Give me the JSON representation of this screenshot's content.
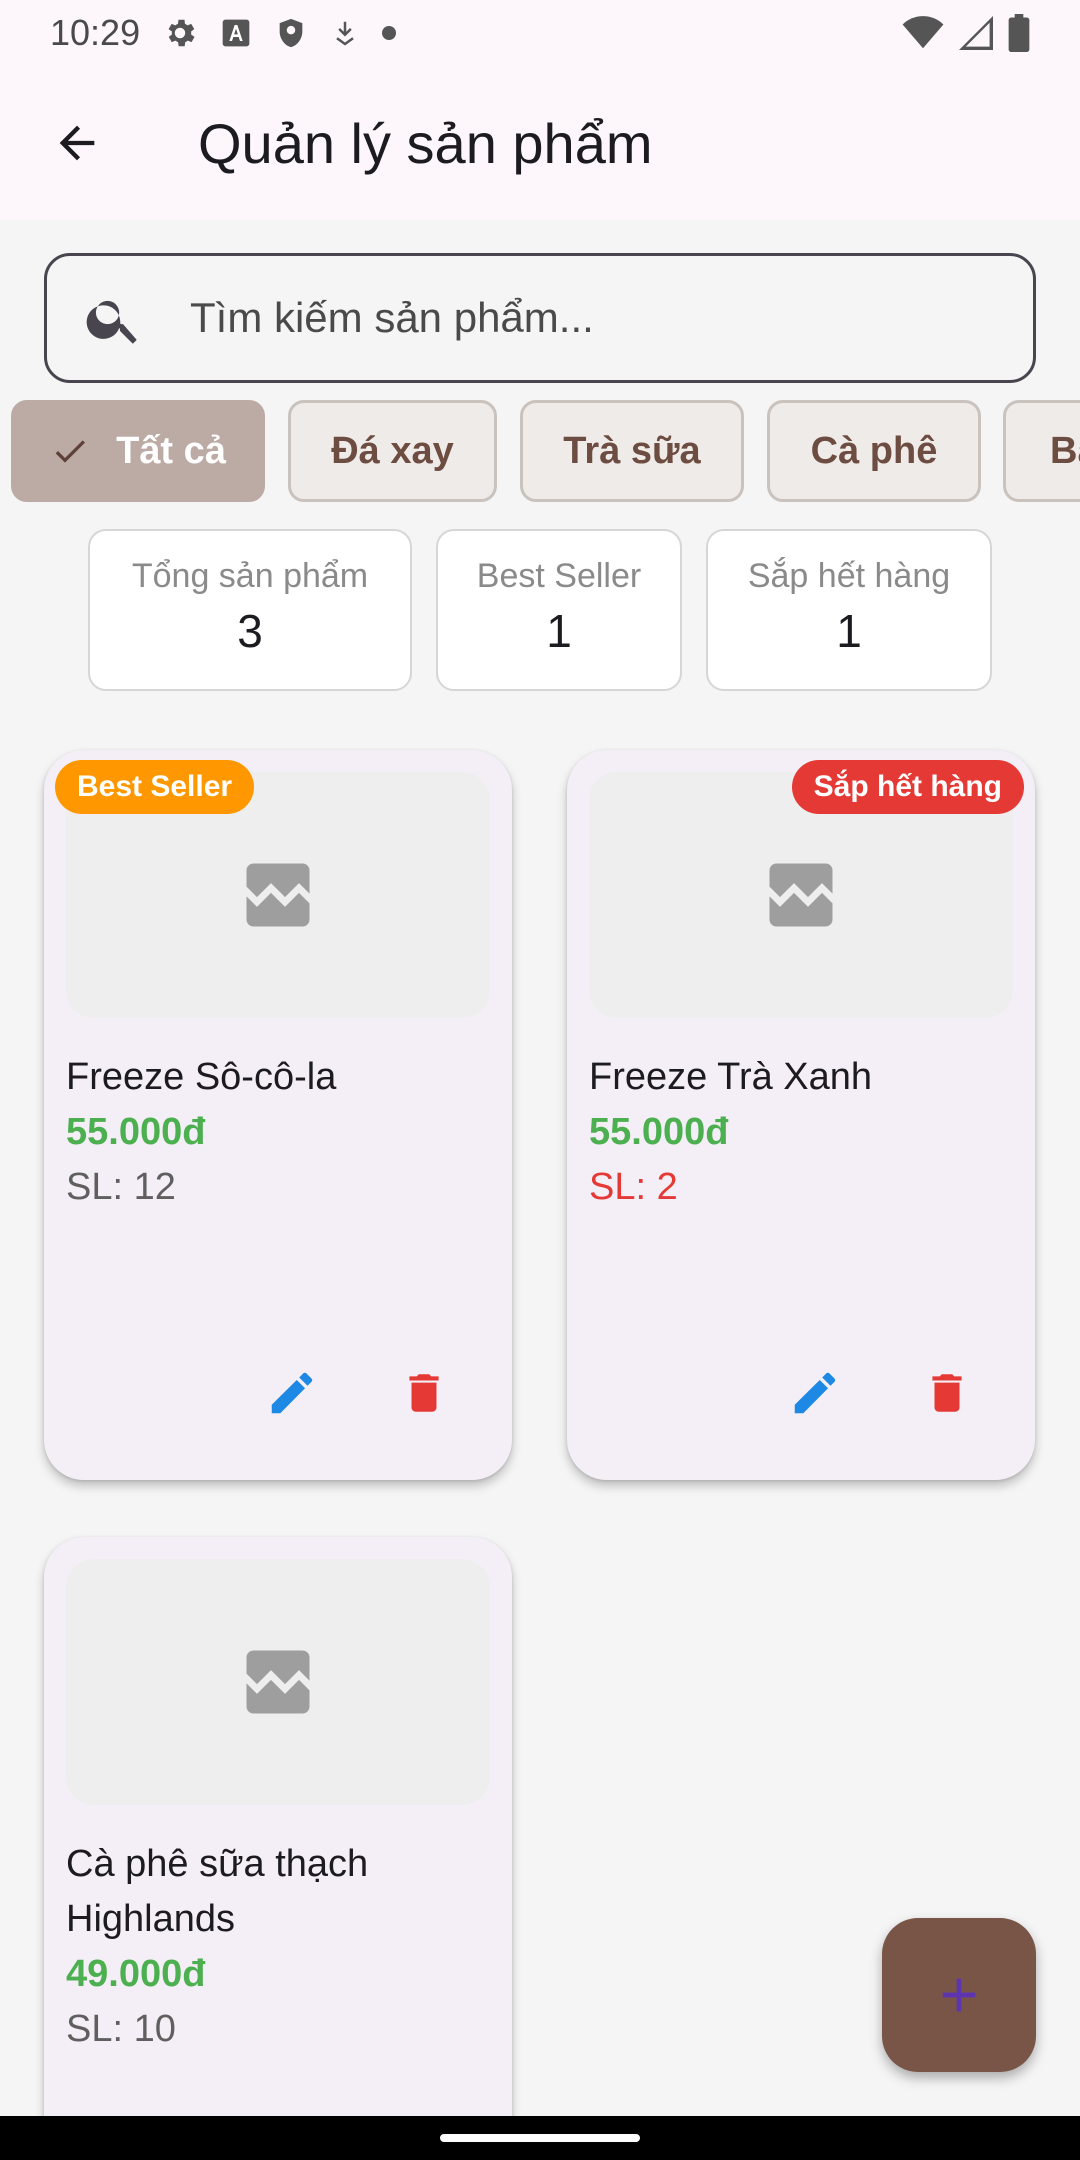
{
  "status_bar": {
    "time": "10:29",
    "icons_left": [
      "gear-icon",
      "font-a-icon",
      "shield-icon",
      "download-icon",
      "dot-icon"
    ],
    "icons_right": [
      "wifi-icon",
      "signal-icon",
      "battery-icon"
    ]
  },
  "app_bar": {
    "title": "Quản lý sản phẩm",
    "back_icon": "arrow-back-icon"
  },
  "search": {
    "placeholder": "Tìm kiếm sản phẩm...",
    "icon": "search-icon"
  },
  "filters": [
    {
      "label": "Tất cả",
      "selected": true
    },
    {
      "label": "Đá xay",
      "selected": false
    },
    {
      "label": "Trà sữa",
      "selected": false
    },
    {
      "label": "Cà phê",
      "selected": false
    },
    {
      "label": "Ba",
      "selected": false
    }
  ],
  "stats": [
    {
      "label": "Tổng sản phẩm",
      "value": "3"
    },
    {
      "label": "Best Seller",
      "value": "1"
    },
    {
      "label": "Sắp hết hàng",
      "value": "1"
    }
  ],
  "products": [
    {
      "name": "Freeze Sô-cô-la",
      "price": "55.000đ",
      "qty": "SL: 12",
      "badge": "Best Seller",
      "badge_color": "#ff9800",
      "low_stock": false
    },
    {
      "name": "Freeze Trà Xanh",
      "price": "55.000đ",
      "qty": "SL: 2",
      "badge": "Sắp hết hàng",
      "badge_color": "#e53935",
      "low_stock": true
    },
    {
      "name": "Cà phê sữa thạch Highlands",
      "price": "49.000đ",
      "qty": "SL: 10",
      "badge": "",
      "low_stock": false
    }
  ],
  "colors": {
    "price_green": "#4caf50",
    "low_stock_red": "#e53935",
    "edit_blue": "#1e88e5",
    "delete_red": "#e53935",
    "fab_brown": "#795548",
    "fab_icon": "#5e35b1"
  }
}
